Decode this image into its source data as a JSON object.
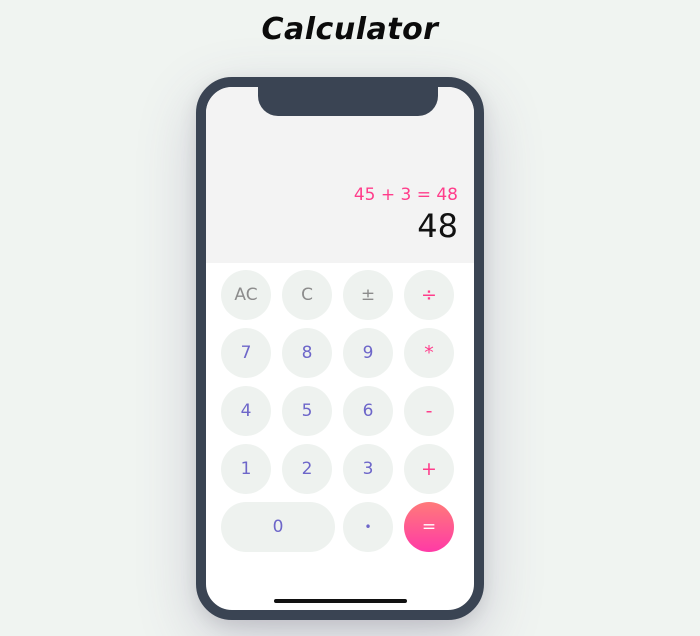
{
  "app": {
    "title": "Calculator"
  },
  "display": {
    "expression": "45 + 3 = 48",
    "result": "48"
  },
  "keys": {
    "ac": "AC",
    "clear": "C",
    "sign": "±",
    "divide": "÷",
    "seven": "7",
    "eight": "8",
    "nine": "9",
    "multiply": "*",
    "four": "4",
    "five": "5",
    "six": "6",
    "subtract": "-",
    "one": "1",
    "two": "2",
    "three": "3",
    "add": "+",
    "zero": "0",
    "decimal": "•",
    "equals": "="
  },
  "colors": {
    "background": "#f0f4f1",
    "phone_frame": "#3a4453",
    "display_bg": "#f3f3f3",
    "key_bg": "#eef2ef",
    "digit": "#6d66c9",
    "operator": "#ff3d8b",
    "function": "#8c8c8c",
    "equals_gradient_top": "#ff7a7a",
    "equals_gradient_bottom": "#ff3aa6"
  }
}
